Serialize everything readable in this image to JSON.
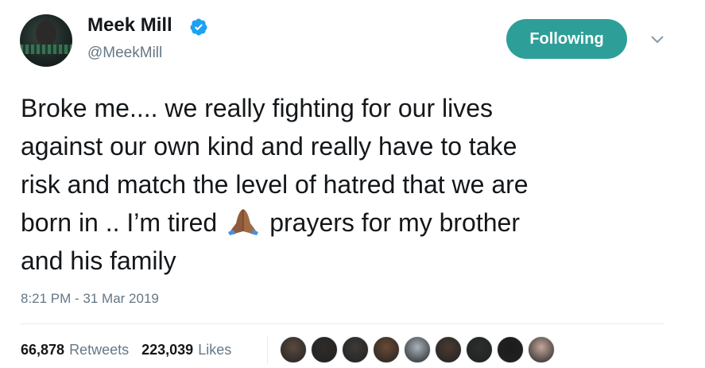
{
  "author": {
    "name": "Meek Mill",
    "handle": "@MeekMill",
    "verified": true,
    "avatar_icon": "profile-avatar"
  },
  "follow_button": {
    "label": "Following",
    "color": "#2d9f98"
  },
  "menu_icon": "chevron-down-icon",
  "tweet": {
    "text_part1": "Broke me.... we really fighting for our lives\nagainst our own kind and really have to take\nrisk and match the level of hatred that we are\nborn in .. I’m tired",
    "emoji": "folded-hands-emoji",
    "text_part2": "prayers for my brother\nand his family",
    "timestamp": "8:21 PM - 31 Mar 2019"
  },
  "stats": {
    "retweets_count": "66,878",
    "retweets_label": "Retweets",
    "likes_count": "223,039",
    "likes_label": "Likes"
  },
  "likers": [
    {
      "color": "#5b4a3e"
    },
    {
      "color": "#2f2b28"
    },
    {
      "color": "#3d3a36"
    },
    {
      "color": "#6b4a35"
    },
    {
      "color": "#a9b4bd"
    },
    {
      "color": "#4a3a30"
    },
    {
      "color": "#2a2e2c"
    },
    {
      "color": "#1e1c1b"
    },
    {
      "color": "#c4a69a"
    }
  ],
  "colors": {
    "text": "#14171a",
    "secondary": "#657786",
    "verified_blue": "#1da1f2"
  }
}
